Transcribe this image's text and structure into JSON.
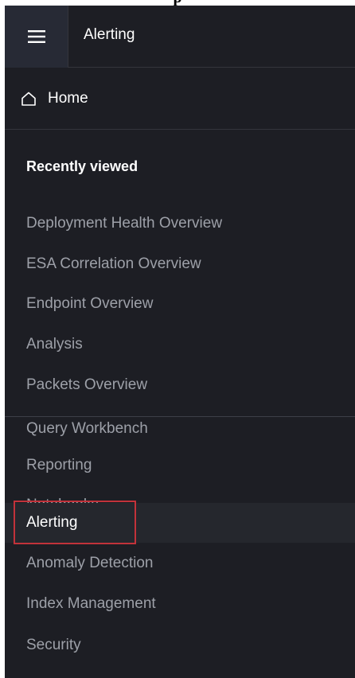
{
  "header": {
    "page_label": "p",
    "app_title": "Alerting"
  },
  "home": {
    "label": "Home"
  },
  "recently_viewed": {
    "title": "Recently viewed",
    "items": [
      "Deployment Health Overview",
      "ESA Correlation Overview",
      "Endpoint Overview",
      "Analysis",
      "Packets Overview"
    ]
  },
  "plugins": {
    "items": [
      "Query Workbench",
      "Reporting",
      "Notebooks",
      "Alerting",
      "Anomaly Detection",
      "Index Management",
      "Security"
    ],
    "active": "Alerting"
  },
  "colors": {
    "panel_bg": "#1d1e24",
    "menu_button_bg": "#272a35",
    "active_row_bg": "#25272d",
    "highlight_border": "#c2323a",
    "muted_text": "#9da0a8"
  },
  "icons": {
    "menu": "hamburger-icon",
    "home": "home-icon"
  }
}
